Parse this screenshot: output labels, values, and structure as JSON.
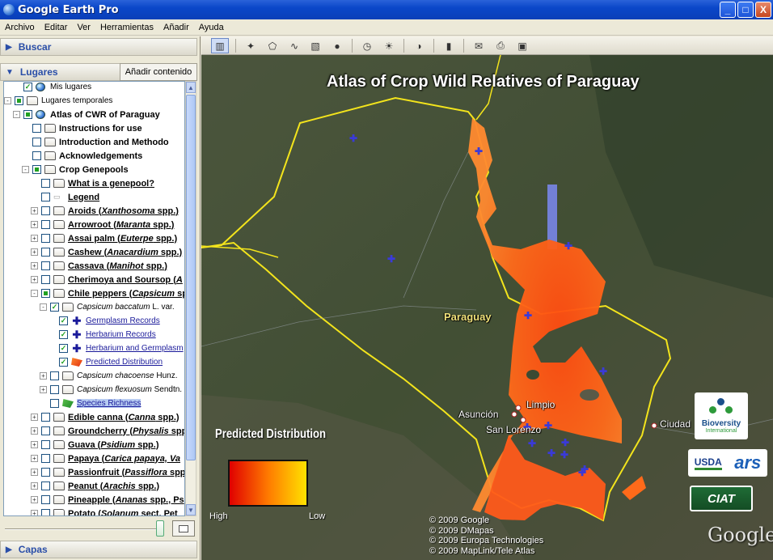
{
  "window": {
    "title": "Google Earth Pro",
    "buttons": [
      "_",
      "□",
      "X"
    ]
  },
  "menu": [
    "Archivo",
    "Editar",
    "Ver",
    "Herramientas",
    "Añadir",
    "Ayuda"
  ],
  "left_panel": {
    "search_label": "Buscar",
    "places_label": "Lugares",
    "add_content_label": "Añadir contenido",
    "layers_label": "Capas",
    "tree": [
      {
        "label": "Mis lugares",
        "indent": 1,
        "expander": "",
        "check": "checked",
        "icon": "globe"
      },
      {
        "label": "Lugares temporales",
        "indent": 0,
        "expander": "-",
        "check": "partial",
        "icon": "folder"
      },
      {
        "label": "Atlas of CWR of Paraguay",
        "indent": 1,
        "expander": "-",
        "check": "partial",
        "icon": "globe",
        "bold": true
      },
      {
        "label": "Instructions for use",
        "indent": 2,
        "expander": "",
        "check": "empty",
        "icon": "folder",
        "bold": true
      },
      {
        "label": "Introduction and Methodo",
        "indent": 2,
        "expander": "",
        "check": "empty",
        "icon": "folder",
        "bold": true
      },
      {
        "label": "Acknowledgements",
        "indent": 2,
        "expander": "",
        "check": "empty",
        "icon": "folder",
        "bold": true
      },
      {
        "label": "Crop Genepools",
        "indent": 2,
        "expander": "-",
        "check": "partial",
        "icon": "folder",
        "bold": true
      },
      {
        "label": "What is a genepool?",
        "indent": 3,
        "expander": "",
        "check": "empty",
        "icon": "folder",
        "bold": true,
        "underline": true
      },
      {
        "label": "Legend",
        "indent": 3,
        "expander": "",
        "check": "empty",
        "icon": "legend",
        "bold": true,
        "underline": true
      },
      {
        "label": "Aroids (",
        "sci": "Xanthosoma",
        "after": " spp.)",
        "indent": 3,
        "expander": "+",
        "check": "empty",
        "icon": "folder",
        "bold": true,
        "underline": true
      },
      {
        "label": "Arrowroot (",
        "sci": "Maranta",
        "after": " spp.)",
        "indent": 3,
        "expander": "+",
        "check": "empty",
        "icon": "folder",
        "bold": true,
        "underline": true
      },
      {
        "label": "Assai palm (",
        "sci": "Euterpe",
        "after": " spp.)",
        "indent": 3,
        "expander": "+",
        "check": "empty",
        "icon": "folder",
        "bold": true,
        "underline": true
      },
      {
        "label": "Cashew (",
        "sci": "Anacardium",
        "after": " spp.)",
        "indent": 3,
        "expander": "+",
        "check": "empty",
        "icon": "folder",
        "bold": true,
        "underline": true
      },
      {
        "label": "Cassava (",
        "sci": "Manihot",
        "after": " spp.)",
        "indent": 3,
        "expander": "+",
        "check": "empty",
        "icon": "folder",
        "bold": true,
        "underline": true
      },
      {
        "label": "Cherimoya and Soursop (",
        "sci": "A",
        "after": "",
        "indent": 3,
        "expander": "+",
        "check": "empty",
        "icon": "folder",
        "bold": true,
        "underline": true
      },
      {
        "label": "Chile peppers (",
        "sci": "Capsicum",
        "after": " sp",
        "indent": 3,
        "expander": "-",
        "check": "partial",
        "icon": "folder",
        "bold": true,
        "underline": true
      },
      {
        "label": "",
        "sci": "Capsicum baccatum",
        "after": " L. var.",
        "indent": 4,
        "expander": "-",
        "check": "checked",
        "icon": "folder"
      },
      {
        "label": "Germplasm Records",
        "indent": 5,
        "expander": "",
        "check": "checked",
        "icon": "plus",
        "link": true
      },
      {
        "label": "Herbarium Records",
        "indent": 5,
        "expander": "",
        "check": "checked",
        "icon": "plus",
        "link": true
      },
      {
        "label": "Herbarium and Germplasm",
        "indent": 5,
        "expander": "",
        "check": "checked",
        "icon": "plus",
        "link": true
      },
      {
        "label": "Predicted Distribution",
        "indent": 5,
        "expander": "",
        "check": "checked",
        "icon": "pd",
        "link": true
      },
      {
        "label": "",
        "sci": "Capsicum chacoense",
        "after": " Hunz.",
        "indent": 4,
        "expander": "+",
        "check": "empty",
        "icon": "folder"
      },
      {
        "label": "",
        "sci": "Capsicum flexuosum",
        "after": " Sendtn.",
        "indent": 4,
        "expander": "+",
        "check": "empty",
        "icon": "folder"
      },
      {
        "label": "Species Richness",
        "indent": 4,
        "expander": "",
        "check": "empty",
        "icon": "sr",
        "link": true,
        "selected": true
      },
      {
        "label": "Edible canna (",
        "sci": "Canna",
        "after": " spp.)",
        "indent": 3,
        "expander": "+",
        "check": "empty",
        "icon": "folder",
        "bold": true,
        "underline": true
      },
      {
        "label": "Groundcherry (",
        "sci": "Physalis",
        "after": " spp.)",
        "indent": 3,
        "expander": "+",
        "check": "empty",
        "icon": "folder",
        "bold": true,
        "underline": true
      },
      {
        "label": "Guava (",
        "sci": "Psidium",
        "after": " spp.)",
        "indent": 3,
        "expander": "+",
        "check": "empty",
        "icon": "folder",
        "bold": true,
        "underline": true
      },
      {
        "label": "Papaya (",
        "sci": "Carica papaya, Va",
        "after": "",
        "indent": 3,
        "expander": "+",
        "check": "empty",
        "icon": "folder",
        "bold": true,
        "underline": true
      },
      {
        "label": "Passionfruit (",
        "sci": "Passiflora",
        "after": " spp",
        "indent": 3,
        "expander": "+",
        "check": "empty",
        "icon": "folder",
        "bold": true,
        "underline": true
      },
      {
        "label": "Peanut (",
        "sci": "Arachis",
        "after": " spp.)",
        "indent": 3,
        "expander": "+",
        "check": "empty",
        "icon": "folder",
        "bold": true,
        "underline": true
      },
      {
        "label": "Pineapple (",
        "sci": "Ananas",
        "after": " spp., Ps",
        "indent": 3,
        "expander": "+",
        "check": "empty",
        "icon": "folder",
        "bold": true,
        "underline": true
      },
      {
        "label": "Potato (",
        "sci": "Solanum",
        "after": " sect. Pet",
        "indent": 3,
        "expander": "+",
        "check": "empty",
        "icon": "folder",
        "bold": true,
        "underline": true
      }
    ]
  },
  "toolbar": {
    "buttons": [
      "sidebar-toggle-icon",
      "placemark-icon",
      "polygon-icon",
      "path-icon",
      "image-overlay-icon",
      "record-tour-icon",
      "historical-imagery-icon",
      "sunlight-icon",
      "planets-icon",
      "ruler-icon",
      "email-icon",
      "print-icon",
      "save-image-icon"
    ]
  },
  "map": {
    "title": "Atlas of Crop Wild Relatives of Paraguay",
    "places": {
      "paraguay": "Paraguay",
      "limpio": "Limpio",
      "asuncion": "Asunción",
      "san_lorenzo": "San Lorenzo",
      "ciudad": "Ciudad"
    },
    "legend": {
      "title": "Predicted Distribution",
      "high": "High",
      "low": "Low",
      "colors": [
        "#e00000",
        "#ff7a00",
        "#ffe200"
      ]
    },
    "copyright": [
      "© 2009 Google",
      "© 2009 DMapas",
      "© 2009 Europa Technologies",
      "© 2009 MapLink/Tele Atlas"
    ],
    "logos": {
      "bioversity": "Bioversity",
      "bioversity_sub": "International",
      "usda": "USDA",
      "ars": "ars",
      "ciat": "CIAT",
      "google": "Google"
    }
  }
}
